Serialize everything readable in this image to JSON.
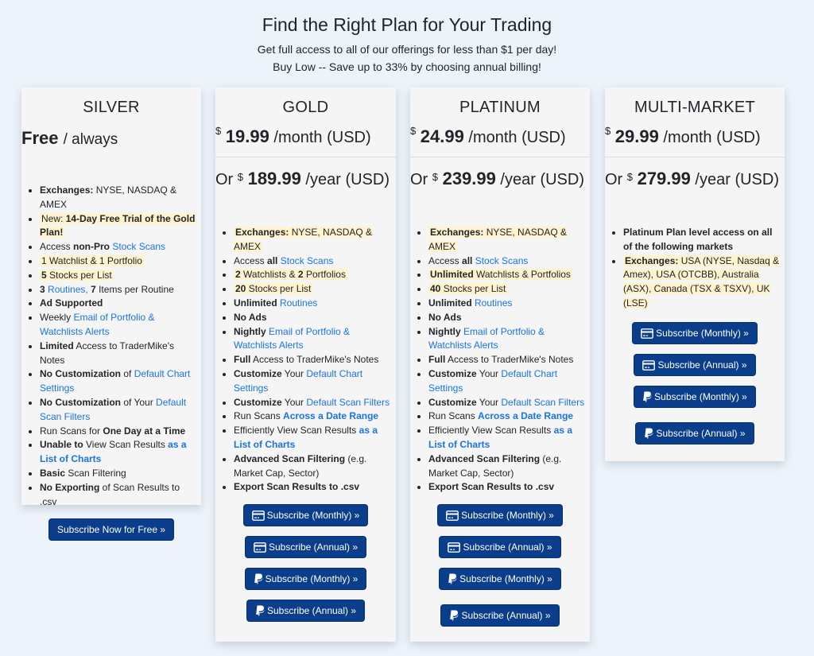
{
  "header": {
    "title": "Find the Right Plan for Your Trading",
    "subtitle1": "Get full access to all of our offerings for less than $1 per day!",
    "subtitle2": "Buy Low -- Save up to 33% by choosing annual billing!"
  },
  "currency_symbol": "$",
  "plans": {
    "silver": {
      "name": "SILVER",
      "price": "Free",
      "period": "/ always",
      "features": {
        "f1_b": "Exchanges:",
        "f1_t": " NYSE, NASDAQ & AMEX",
        "f2_t": " New: ",
        "f2_b": "14-Day Free Trial of the Gold Plan!",
        "f3_t": "Access ",
        "f3_b": "non-Pro",
        "f3_l": "Stock Scans",
        "f4_t": " 1 Watchlist & 1 Portfolio",
        "f5_b": " 5",
        "f5_t": " Stocks per List",
        "f6_b1": "3",
        "f6_l": "Routines,",
        "f6_b2": "7",
        "f6_t": " Items per Routine",
        "f7_b": "Ad Supported",
        "f8_t": "Weekly ",
        "f8_l": "Email of Portfolio & Watchlists Alerts",
        "f9_b": "Limited",
        "f9_t": " Access to TraderMike's Notes",
        "f10_b": "No Customization",
        "f10_t": " of ",
        "f10_l": "Default Chart Settings",
        "f11_b": "No Customization",
        "f11_t": " of Your ",
        "f11_l": "Default Scan Filters",
        "f12_t": "Run Scans for ",
        "f12_b": "One Day at a Time",
        "f13_b": "Unable to",
        "f13_t": " View Scan Results ",
        "f13_l": "as a List of Charts",
        "f14_b": "Basic",
        "f14_t": " Scan Filtering",
        "f15_b": "No Exporting",
        "f15_t": " of Scan Results to .csv"
      },
      "button": "Subscribe Now for Free »"
    },
    "gold": {
      "name": "GOLD",
      "monthly_price": "19.99",
      "monthly_suffix": " /month (USD)",
      "or": "Or ",
      "yearly_price": "189.99",
      "yearly_suffix": " /year (USD)",
      "features": {
        "f1_b": " Exchanges:",
        "f1_t": " NYSE, NASDAQ & AMEX",
        "f2_t": "Access ",
        "f2_b": "all",
        "f2_l": "Stock Scans",
        "f3_b1": " 2",
        "f3_t1": " Watchlists & ",
        "f3_b2": "2",
        "f3_t2": " Portfolios",
        "f4_b": " 20",
        "f4_t": " Stocks per List",
        "f5_b": "Unlimited",
        "f5_l": "Routines",
        "f6_b": "No Ads",
        "f7_b": "Nightly",
        "f7_l": "Email of Portfolio & Watchlists Alerts",
        "f8_b": "Full",
        "f8_t": " Access to TraderMike's Notes",
        "f9_b": "Customize",
        "f9_t": " Your ",
        "f9_l": "Default Chart Settings",
        "f10_b": "Customize",
        "f10_t": " Your ",
        "f10_l": "Default Scan Filters",
        "f11_t": "Run Scans ",
        "f11_l": "Across a Date Range",
        "f12_t": "Efficiently View Scan Results ",
        "f12_l": "as a List of Charts",
        "f13_b": "Advanced Scan Filtering",
        "f13_t": " (e.g. Market Cap, Sector)",
        "f14_b": "Export Scan Results to .csv"
      }
    },
    "platinum": {
      "name": "PLATINUM",
      "monthly_price": "24.99",
      "monthly_suffix": " /month (USD)",
      "or": "Or ",
      "yearly_price": "239.99",
      "yearly_suffix": " /year (USD)",
      "features": {
        "f1_b": " Exchanges:",
        "f1_t": " NYSE, NASDAQ & AMEX",
        "f2_t": "Access ",
        "f2_b": "all",
        "f2_l": "Stock Scans",
        "f3_b": " Unlimited",
        "f3_t": " Watchlists & Portfolios",
        "f4_b": " 40",
        "f4_t": " Stocks per List",
        "f5_b": "Unlimited",
        "f5_l": "Routines",
        "f6_b": "No Ads",
        "f7_b": "Nightly",
        "f7_l": "Email of Portfolio & Watchlists Alerts",
        "f8_b": "Full",
        "f8_t": " Access to TraderMike's Notes",
        "f9_b": "Customize",
        "f9_t": " Your ",
        "f9_l": "Default Chart Settings",
        "f10_b": "Customize",
        "f10_t": " Your ",
        "f10_l": "Default Scan Filters",
        "f11_t": "Run Scans ",
        "f11_l": "Across a Date Range",
        "f12_t": "Efficiently View Scan Results ",
        "f12_l": "as a List of Charts",
        "f13_b": "Advanced Scan Filtering",
        "f13_t": " (e.g. Market Cap, Sector)",
        "f14_b": "Export Scan Results to .csv"
      }
    },
    "multi": {
      "name": "MULTI-MARKET",
      "monthly_price": "29.99",
      "monthly_suffix": " /month (USD)",
      "or": "Or ",
      "yearly_price": "279.99",
      "yearly_suffix": " /year (USD)",
      "features": {
        "f1_b": "Platinum Plan level access on all of the following markets",
        "f2_b": " Exchanges:",
        "f2_t": " USA (NYSE, Nasdaq & Amex), USA (OTCBB), Australia (ASX), Canada (TSX & TSXV), UK (LSE)"
      }
    }
  },
  "buttons": {
    "card_monthly": "Subscribe (Monthly) »",
    "card_annual": "Subscribe (Annual) »",
    "paypal_monthly": "Subscribe (Monthly) »",
    "paypal_annual": "Subscribe (Annual) »"
  },
  "colors": {
    "button": "#0a3d8a",
    "link": "#1a73e8",
    "highlight": "#fff3cd",
    "background": "#edf3fa",
    "card": "#f5f5f5"
  }
}
